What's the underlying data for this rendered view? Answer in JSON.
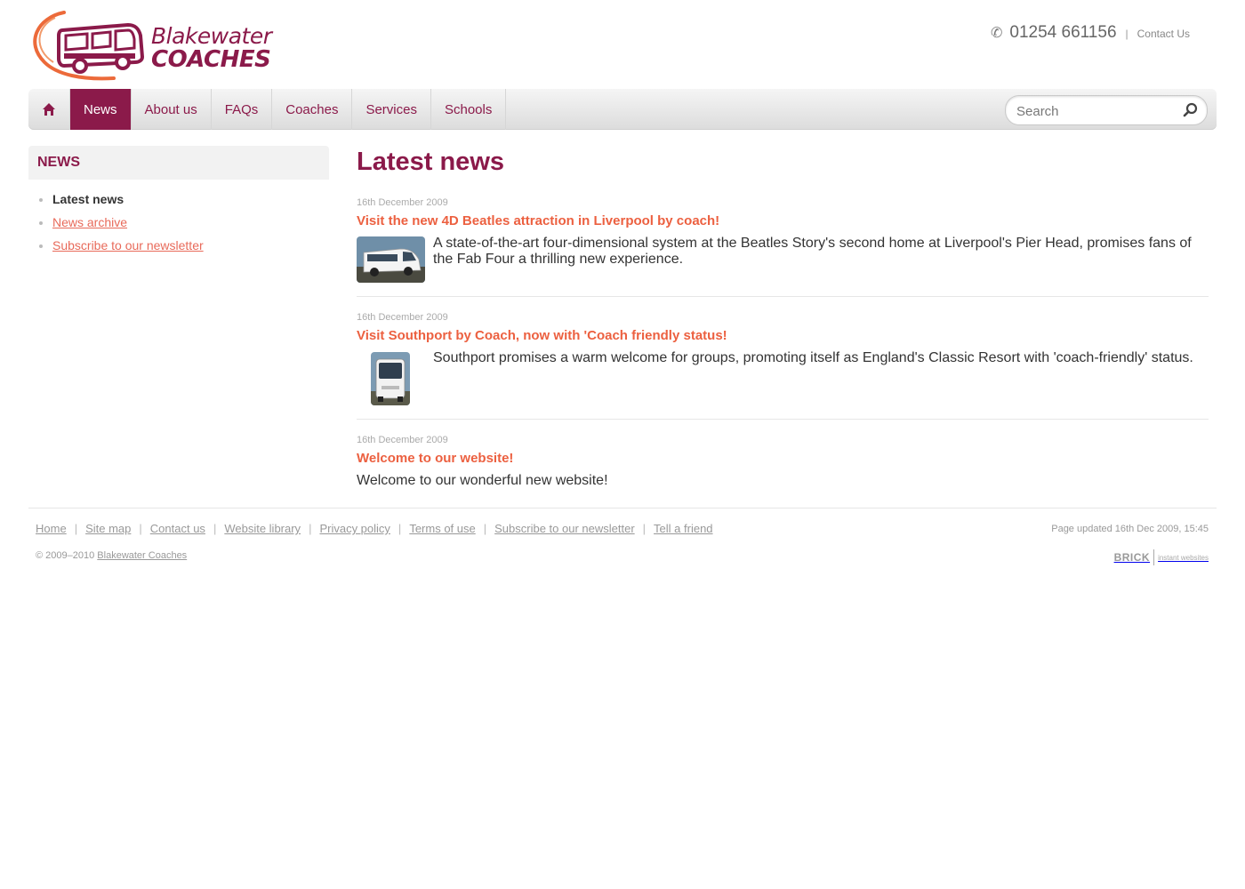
{
  "header": {
    "logo": {
      "line1": "Blakewater",
      "line2": "COACHES"
    },
    "phone": "01254 661156",
    "contact_link": "Contact Us"
  },
  "nav": {
    "items": [
      {
        "label": "News",
        "active": true
      },
      {
        "label": "About us"
      },
      {
        "label": "FAQs"
      },
      {
        "label": "Coaches"
      },
      {
        "label": "Services"
      },
      {
        "label": "Schools"
      }
    ],
    "search_placeholder": "Search"
  },
  "sidebar": {
    "heading": "NEWS",
    "items": [
      {
        "label": "Latest news",
        "current": true
      },
      {
        "label": "News archive"
      },
      {
        "label": "Subscribe to our newsletter"
      }
    ]
  },
  "main": {
    "title": "Latest news",
    "articles": [
      {
        "date": "16th December 2009",
        "headline": "Visit the new 4D Beatles attraction in Liverpool by coach!",
        "summary": "A state-of-the-art four-dimensional system at the Beatles Story's second home at Liverpool's Pier Head, promises fans of the Fab Four a thrilling new experience."
      },
      {
        "date": "16th December 2009",
        "headline": "Visit Southport by Coach, now with 'Coach friendly status!",
        "summary": "Southport promises a warm welcome for groups, promoting itself as England's Classic Resort with 'coach-friendly' status."
      },
      {
        "date": "16th December 2009",
        "headline": "Welcome to our website!",
        "summary": "Welcome to our wonderful new website!"
      }
    ]
  },
  "footer": {
    "links": [
      "Home",
      "Site map",
      "Contact us",
      "Website library",
      "Privacy policy",
      "Terms of use",
      "Subscribe to our newsletter",
      "Tell a friend"
    ],
    "updated": "Page updated 16th Dec 2009, 15:45",
    "copyright_prefix": "© 2009–2010",
    "copyright_link": "Blakewater Coaches",
    "credit_brand": "BRICK",
    "credit_text": "instant websites"
  },
  "colors": {
    "brand": "#8b1a4a",
    "accent": "#ec6040",
    "link": "#e86a5a"
  }
}
